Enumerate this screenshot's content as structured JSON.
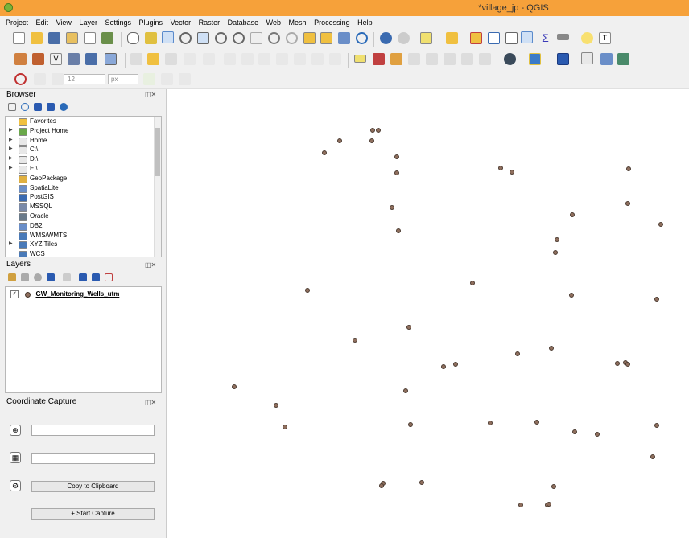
{
  "window": {
    "title": "*village_jp - QGIS"
  },
  "menu": [
    "Project",
    "Edit",
    "View",
    "Layer",
    "Settings",
    "Plugins",
    "Vector",
    "Raster",
    "Database",
    "Web",
    "Mesh",
    "Processing",
    "Help"
  ],
  "toolbar3": {
    "size_value": "12",
    "unit": "px"
  },
  "browser": {
    "title": "Browser",
    "items": [
      {
        "label": "Favorites",
        "icon": "star-icon",
        "expand": false
      },
      {
        "label": "Project Home",
        "icon": "project-home-icon",
        "expand": true
      },
      {
        "label": "Home",
        "icon": "home-folder-icon",
        "expand": true
      },
      {
        "label": "C:\\",
        "icon": "drive-icon",
        "expand": true
      },
      {
        "label": "D:\\",
        "icon": "drive-icon",
        "expand": true
      },
      {
        "label": "E:\\",
        "icon": "drive-icon",
        "expand": true
      },
      {
        "label": "GeoPackage",
        "icon": "geopackage-icon",
        "expand": false
      },
      {
        "label": "SpatiaLite",
        "icon": "spatialite-icon",
        "expand": false
      },
      {
        "label": "PostGIS",
        "icon": "postgis-icon",
        "expand": false
      },
      {
        "label": "MSSQL",
        "icon": "mssql-icon",
        "expand": false
      },
      {
        "label": "Oracle",
        "icon": "oracle-icon",
        "expand": false
      },
      {
        "label": "DB2",
        "icon": "db2-icon",
        "expand": false
      },
      {
        "label": "WMS/WMTS",
        "icon": "wms-icon",
        "expand": false
      },
      {
        "label": "XYZ Tiles",
        "icon": "xyz-tiles-icon",
        "expand": true
      },
      {
        "label": "WCS",
        "icon": "wcs-icon",
        "expand": false
      }
    ]
  },
  "layers": {
    "title": "Layers",
    "items": [
      {
        "name": "GW_Monitoring_Wells_utm",
        "checked": true
      }
    ]
  },
  "coordinate_capture": {
    "title": "Coordinate Capture",
    "copy_label": "Copy to Clipboard",
    "start_label": "Start Capture"
  },
  "colors": {
    "titlebar": "#f6a13a",
    "point_fill": "#8f6f5e",
    "point_stroke": "#4a3a30"
  },
  "map_points": [
    [
      462,
      162
    ],
    [
      469,
      162
    ],
    [
      421,
      175
    ],
    [
      461,
      175
    ],
    [
      402,
      190
    ],
    [
      492,
      195
    ],
    [
      492,
      215
    ],
    [
      621,
      209
    ],
    [
      635,
      214
    ],
    [
      780,
      210
    ],
    [
      779,
      253
    ],
    [
      486,
      258
    ],
    [
      494,
      287
    ],
    [
      710,
      267
    ],
    [
      820,
      279
    ],
    [
      691,
      298
    ],
    [
      689,
      314
    ],
    [
      381,
      361
    ],
    [
      586,
      352
    ],
    [
      709,
      367
    ],
    [
      815,
      372
    ],
    [
      507,
      407
    ],
    [
      440,
      423
    ],
    [
      642,
      440
    ],
    [
      684,
      433
    ],
    [
      550,
      456
    ],
    [
      565,
      453
    ],
    [
      766,
      452
    ],
    [
      776,
      451
    ],
    [
      779,
      453
    ],
    [
      290,
      481
    ],
    [
      503,
      486
    ],
    [
      342,
      504
    ],
    [
      353,
      531
    ],
    [
      509,
      528
    ],
    [
      608,
      526
    ],
    [
      666,
      525
    ],
    [
      713,
      537
    ],
    [
      741,
      540
    ],
    [
      815,
      529
    ],
    [
      810,
      568
    ],
    [
      475,
      601
    ],
    [
      473,
      604
    ],
    [
      523,
      600
    ],
    [
      687,
      605
    ],
    [
      646,
      628
    ],
    [
      679,
      628
    ],
    [
      681,
      627
    ]
  ]
}
